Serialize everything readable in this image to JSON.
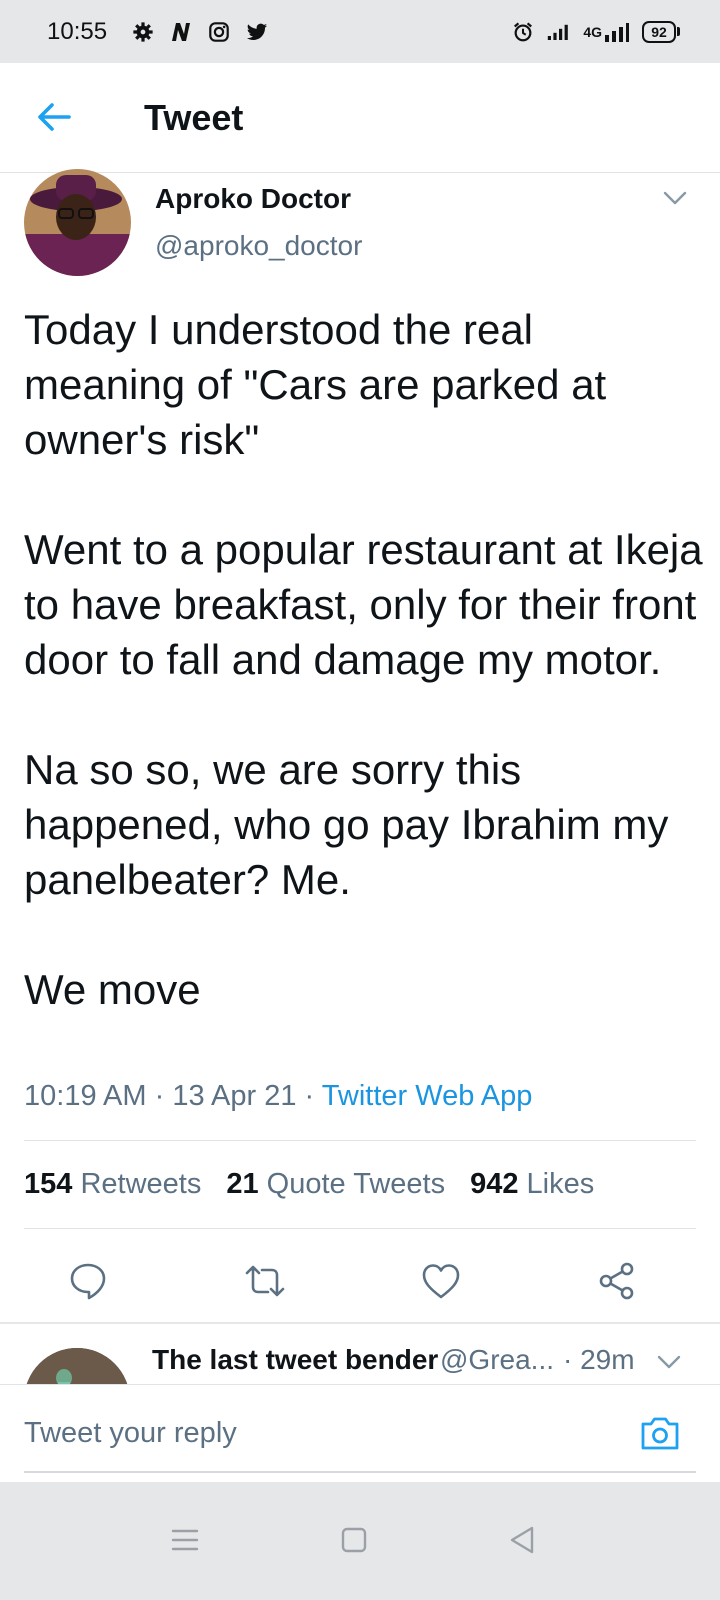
{
  "status_bar": {
    "time": "10:55",
    "left_icons": [
      "settings-gear-icon",
      "n-app-icon",
      "instagram-icon",
      "twitter-bird-icon"
    ],
    "network_label": "4G",
    "battery": "92"
  },
  "header": {
    "title": "Tweet",
    "back_icon": "arrow-left-icon"
  },
  "tweet": {
    "author_name": "Aproko Doctor",
    "author_handle": "@aproko_doctor",
    "paragraphs": [
      "Today I understood the real meaning of \"Cars are parked at owner's risk\"",
      "Went to a popular restaurant at Ikeja to have breakfast, only for their front door to fall and damage my motor.",
      "Na so so, we are sorry this happened, who go pay Ibrahim my panelbeater? Me.",
      "We move"
    ],
    "time": "10:19 AM",
    "separator": "·",
    "date": "13 Apr 21",
    "source": "Twitter Web App"
  },
  "stats": {
    "retweets_count": "154",
    "retweets_label": "Retweets",
    "quotes_count": "21",
    "quotes_label": "Quote Tweets",
    "likes_count": "942",
    "likes_label": "Likes"
  },
  "actions": [
    "reply-icon",
    "retweet-icon",
    "like-icon",
    "share-icon"
  ],
  "reply_preview": {
    "name": "The last tweet bender",
    "handle": "@Grea...",
    "time": "· 29m"
  },
  "composer": {
    "placeholder": "Tweet your reply"
  },
  "colors": {
    "accent": "#1da1f2",
    "link": "#1b95e0",
    "secondary_text": "#5b7083",
    "primary_text": "#0f1419",
    "system_bar": "#e6e7e9"
  }
}
